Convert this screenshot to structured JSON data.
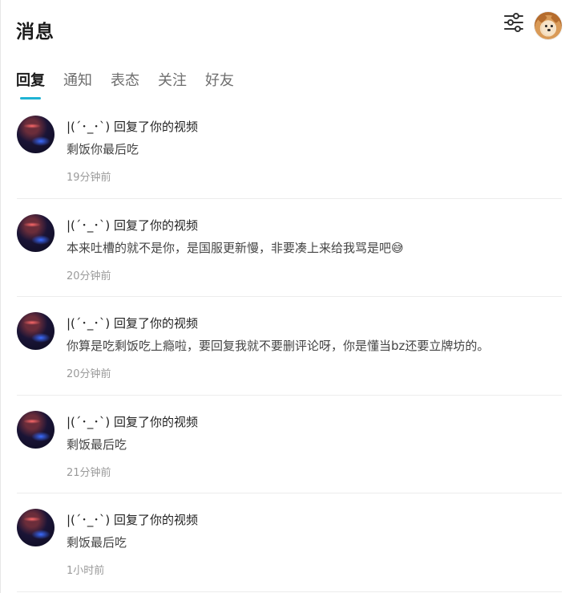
{
  "header": {
    "title": "消息",
    "settings_icon": "sliders-icon",
    "avatar_icon": "shiba-avatar-icon"
  },
  "tabs": [
    {
      "label": "回复",
      "active": true
    },
    {
      "label": "通知",
      "active": false
    },
    {
      "label": "表态",
      "active": false
    },
    {
      "label": "关注",
      "active": false
    },
    {
      "label": "好友",
      "active": false
    }
  ],
  "accent_color": "#1fb3d4",
  "messages": [
    {
      "sender": "|(´･_･`) 回复了你的视频",
      "content": "剩饭你最后吃",
      "time": "19分钟前"
    },
    {
      "sender": "|(´･_･`) 回复了你的视频",
      "content": "本来吐槽的就不是你，是国服更新慢，非要凑上来给我骂是吧😅",
      "time": "20分钟前"
    },
    {
      "sender": "|(´･_･`) 回复了你的视频",
      "content": "你算是吃剩饭吃上瘾啦，要回复我就不要删评论呀，你是懂当bz还要立牌坊的。",
      "time": "20分钟前"
    },
    {
      "sender": "|(´･_･`) 回复了你的视频",
      "content": "剩饭最后吃",
      "time": "21分钟前"
    },
    {
      "sender": "|(´･_･`) 回复了你的视频",
      "content": "剩饭最后吃",
      "time": "1小时前"
    }
  ]
}
